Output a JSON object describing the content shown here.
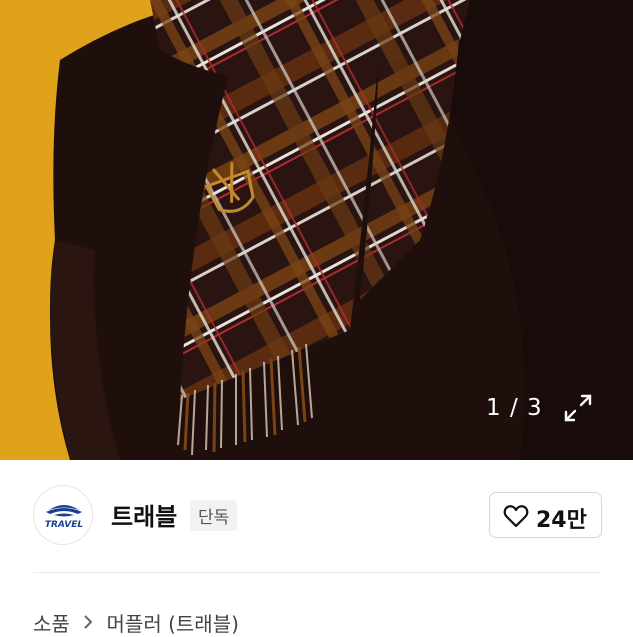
{
  "gallery": {
    "counter": "1 / 3",
    "expand_icon": "expand-icon",
    "product_logo_text": "TRAVEL"
  },
  "brand": {
    "logo_text": "TRAVEL",
    "name": "트래블",
    "badge": "단독",
    "like_icon": "heart-icon",
    "like_count": "24만"
  },
  "breadcrumb": {
    "items": [
      "소품",
      "머플러 (트래블)"
    ],
    "separator_icon": "chevron-right-icon"
  },
  "colors": {
    "background_yellow": "#e2a418",
    "scarf_dark": "#2b1413",
    "accent_red": "#8b1e24"
  }
}
